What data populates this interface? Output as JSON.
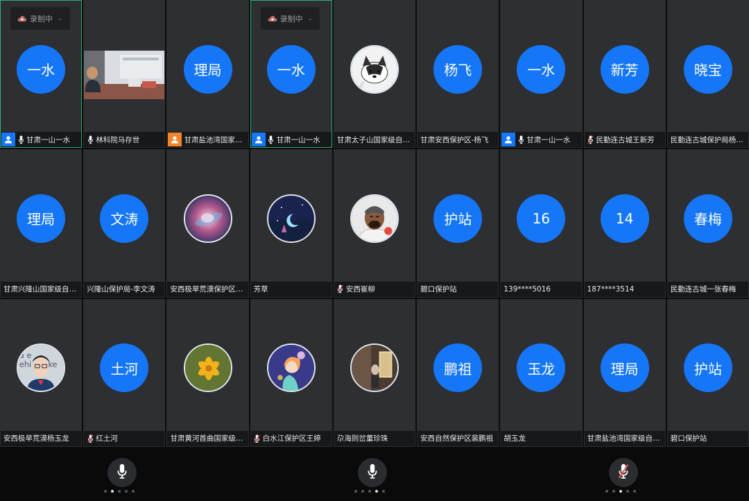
{
  "recording_label": "录制中",
  "participants": [
    {
      "avatar_text": "一水",
      "avatar_type": "text",
      "name": "甘肃一山一水",
      "host": "blue",
      "mic": "on",
      "recording": true,
      "active": true
    },
    {
      "avatar_text": "",
      "avatar_type": "video",
      "name": "林科院马存世",
      "host": "",
      "mic": "on",
      "recording": false,
      "active": false
    },
    {
      "avatar_text": "理局",
      "avatar_type": "text",
      "name": "甘肃盐池湾国家…",
      "host": "orange",
      "mic": "",
      "recording": false,
      "active": false
    },
    {
      "avatar_text": "一水",
      "avatar_type": "text",
      "name": "甘肃一山一水",
      "host": "blue",
      "mic": "on",
      "recording": true,
      "active": true
    },
    {
      "avatar_text": "",
      "avatar_type": "dog",
      "name": "甘肃太子山国家级自…",
      "host": "",
      "mic": "",
      "recording": false,
      "active": false
    },
    {
      "avatar_text": "杨飞",
      "avatar_type": "text",
      "name": "甘肃安西保护区-杨飞",
      "host": "",
      "mic": "",
      "recording": false,
      "active": false
    },
    {
      "avatar_text": "一水",
      "avatar_type": "text",
      "name": "甘肃一山一水",
      "host": "blue",
      "mic": "on",
      "recording": false,
      "active": false
    },
    {
      "avatar_text": "新芳",
      "avatar_type": "text",
      "name": "民勤连古城王新芳",
      "host": "",
      "mic": "muted",
      "recording": false,
      "active": false
    },
    {
      "avatar_text": "晓宝",
      "avatar_type": "text",
      "name": "民勤连古城保护局杨…",
      "host": "",
      "mic": "",
      "recording": false,
      "active": false
    },
    {
      "avatar_text": "理局",
      "avatar_type": "text",
      "name": "甘肃兴隆山国家级自…",
      "host": "",
      "mic": "",
      "recording": false,
      "active": false
    },
    {
      "avatar_text": "文涛",
      "avatar_type": "text",
      "name": "兴隆山保护局-李文涛",
      "host": "",
      "mic": "",
      "recording": false,
      "active": false
    },
    {
      "avatar_text": "",
      "avatar_type": "galaxy",
      "name": "安西极旱荒漠保护区…",
      "host": "",
      "mic": "",
      "recording": false,
      "active": false
    },
    {
      "avatar_text": "",
      "avatar_type": "moon",
      "name": "芳草",
      "host": "",
      "mic": "",
      "recording": false,
      "active": false
    },
    {
      "avatar_text": "",
      "avatar_type": "man",
      "name": "安西崔柳",
      "host": "",
      "mic": "muted",
      "recording": false,
      "active": false
    },
    {
      "avatar_text": "护站",
      "avatar_type": "text",
      "name": "碧口保护站",
      "host": "",
      "mic": "",
      "recording": false,
      "active": false
    },
    {
      "avatar_text": "16",
      "avatar_type": "text",
      "name": "139****5016",
      "host": "",
      "mic": "",
      "recording": false,
      "active": false
    },
    {
      "avatar_text": "14",
      "avatar_type": "text",
      "name": "187****3514",
      "host": "",
      "mic": "",
      "recording": false,
      "active": false
    },
    {
      "avatar_text": "春梅",
      "avatar_type": "text",
      "name": "民勤连古城一张春梅",
      "host": "",
      "mic": "",
      "recording": false,
      "active": false
    },
    {
      "avatar_text": "",
      "avatar_type": "boy",
      "name": "安西极旱荒漠杨玉龙",
      "host": "",
      "mic": "",
      "recording": false,
      "active": false
    },
    {
      "avatar_text": "土河",
      "avatar_type": "text",
      "name": "红土河",
      "host": "",
      "mic": "muted",
      "recording": false,
      "active": false
    },
    {
      "avatar_text": "",
      "avatar_type": "flower",
      "name": "甘肃黄河首曲国家级…",
      "host": "",
      "mic": "",
      "recording": false,
      "active": false
    },
    {
      "avatar_text": "",
      "avatar_type": "girl",
      "name": "白水江保护区王婷",
      "host": "",
      "mic": "muted",
      "recording": false,
      "active": false
    },
    {
      "avatar_text": "",
      "avatar_type": "room",
      "name": "尕海则岔董珍珠",
      "host": "",
      "mic": "",
      "recording": false,
      "active": false
    },
    {
      "avatar_text": "鹏祖",
      "avatar_type": "text",
      "name": "安西自然保护区裴鹏祖",
      "host": "",
      "mic": "",
      "recording": false,
      "active": false
    },
    {
      "avatar_text": "玉龙",
      "avatar_type": "text",
      "name": "胡玉龙",
      "host": "",
      "mic": "",
      "recording": false,
      "active": false
    },
    {
      "avatar_text": "理局",
      "avatar_type": "text",
      "name": "甘肃盐池湾国家级自…",
      "host": "",
      "mic": "",
      "recording": false,
      "active": false
    },
    {
      "avatar_text": "护站",
      "avatar_type": "text",
      "name": "碧口保护站",
      "host": "",
      "mic": "",
      "recording": false,
      "active": false
    }
  ],
  "bottom_controls": [
    {
      "name": "mic-button-1",
      "state": "on",
      "page_dots": 5,
      "active_dot": 1
    },
    {
      "name": "mic-button-2",
      "state": "on",
      "page_dots": 5,
      "active_dot": 3
    },
    {
      "name": "mic-button-3",
      "state": "muted",
      "page_dots": 5,
      "active_dot": 2
    }
  ],
  "colors": {
    "avatar_blue": "#1577f7",
    "active_border": "#27b36a",
    "host_orange": "#f2842b",
    "muted_red": "#e8584e",
    "tile_bg": "#2d2f33"
  }
}
